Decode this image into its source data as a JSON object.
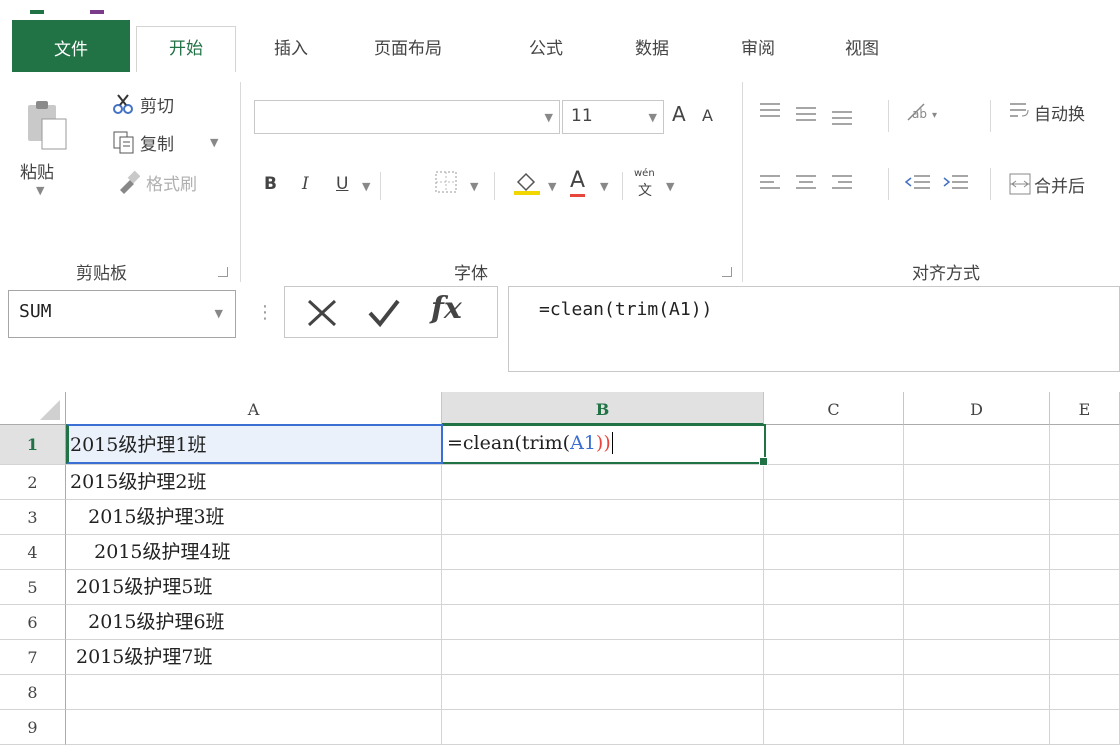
{
  "tabs": [
    {
      "label": "文件"
    },
    {
      "label": "开始"
    },
    {
      "label": "插入"
    },
    {
      "label": "页面布局"
    },
    {
      "label": "公式"
    },
    {
      "label": "数据"
    },
    {
      "label": "审阅"
    },
    {
      "label": "视图"
    }
  ],
  "active_tab": "开始",
  "clipboard": {
    "paste": "粘贴",
    "cut": "剪切",
    "copy": "复制",
    "format_painter": "格式刷",
    "group_label": "剪贴板"
  },
  "font": {
    "size": "11",
    "bold": "B",
    "italic": "I",
    "underline": "U",
    "font_color_glyph": "A",
    "grow_glyph": "A",
    "shrink_glyph": "A",
    "phonetic_top": "wén",
    "phonetic_bottom": "文",
    "group_label": "字体"
  },
  "alignment": {
    "wrap_text": "自动换",
    "merge": "合并后",
    "group_label": "对齐方式"
  },
  "formula_bar": {
    "name_box": "SUM",
    "fx": "fx",
    "formula": "=clean(trim(A1))"
  },
  "columns": [
    "A",
    "B",
    "C",
    "D",
    "E"
  ],
  "selected_column": "B",
  "rows": [
    {
      "num": "1",
      "a": "2015级护理1班"
    },
    {
      "num": "2",
      "a": "2015级护理2班"
    },
    {
      "num": "3",
      "a": "   2015级护理3班"
    },
    {
      "num": "4",
      "a": "    2015级护理4班"
    },
    {
      "num": "5",
      "a": " 2015级护理5班"
    },
    {
      "num": "6",
      "a": "   2015级护理6班"
    },
    {
      "num": "7",
      "a": " 2015级护理7班"
    },
    {
      "num": "8",
      "a": ""
    },
    {
      "num": "9",
      "a": ""
    }
  ],
  "edit_cell": {
    "prefix": "=clean(trim(",
    "ref": "A1",
    "suffix": "))"
  },
  "colors": {
    "accent": "#217346",
    "ref_blue": "#3b6fd4",
    "ref_red": "#e8463c"
  }
}
